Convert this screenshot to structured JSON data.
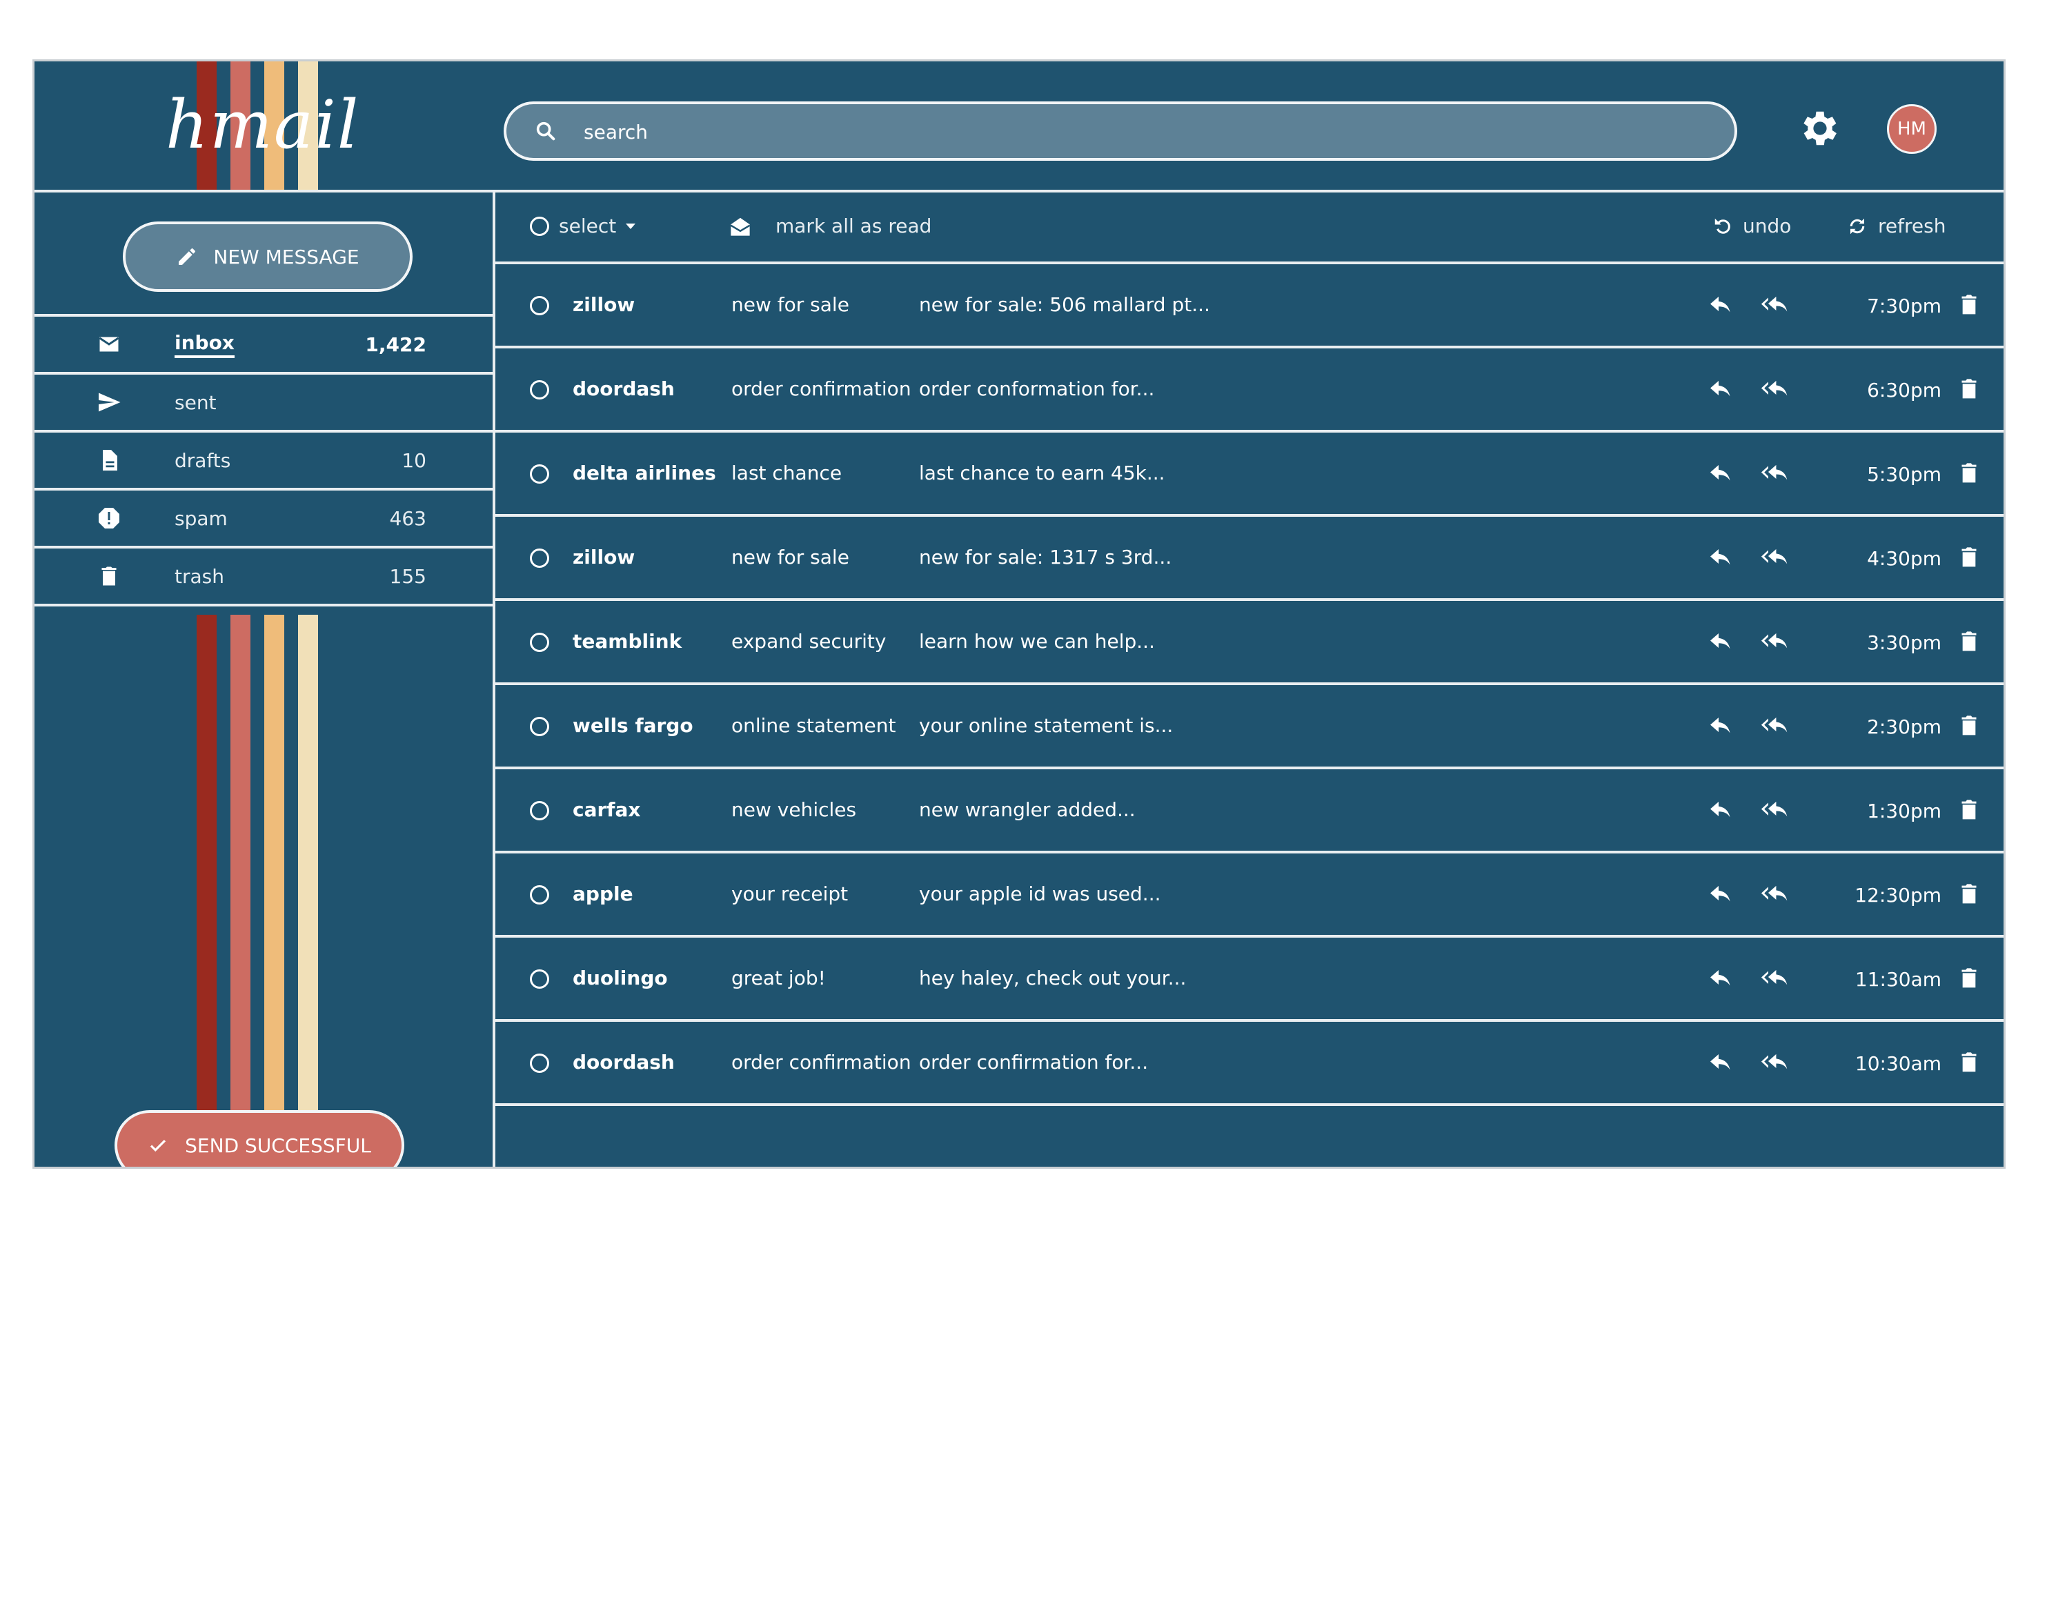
{
  "app": {
    "logo": "hmail"
  },
  "header": {
    "search_placeholder": "search",
    "avatar_initials": "HM"
  },
  "sidebar": {
    "new_message_label": "NEW MESSAGE",
    "items": [
      {
        "label": "inbox",
        "count": "1,422",
        "icon": "envelope-icon",
        "active": true
      },
      {
        "label": "sent",
        "count": "",
        "icon": "send-icon"
      },
      {
        "label": "drafts",
        "count": "10",
        "icon": "document-icon"
      },
      {
        "label": "spam",
        "count": "463",
        "icon": "alert-icon"
      },
      {
        "label": "trash",
        "count": "155",
        "icon": "trash-icon"
      }
    ],
    "toast_label": "SEND SUCCESSFUL"
  },
  "toolbar": {
    "select_label": "select",
    "mark_read_label": "mark all as read",
    "undo_label": "undo",
    "refresh_label": "refresh"
  },
  "emails": [
    {
      "from": "zillow",
      "subject": "new for sale",
      "preview": "new for sale: 506 mallard pt...",
      "time": "7:30pm"
    },
    {
      "from": "doordash",
      "subject": "order confirmation",
      "preview": "order conformation for...",
      "time": "6:30pm"
    },
    {
      "from": "delta airlines",
      "subject": "last chance",
      "preview": "last chance to earn 45k...",
      "time": "5:30pm"
    },
    {
      "from": "zillow",
      "subject": "new for sale",
      "preview": "new for sale: 1317 s 3rd...",
      "time": "4:30pm"
    },
    {
      "from": "teamblink",
      "subject": "expand security",
      "preview": "learn how we can help...",
      "time": "3:30pm"
    },
    {
      "from": "wells fargo",
      "subject": "online statement",
      "preview": "your online statement is...",
      "time": "2:30pm"
    },
    {
      "from": "carfax",
      "subject": "new vehicles",
      "preview": "new wrangler added...",
      "time": "1:30pm"
    },
    {
      "from": "apple",
      "subject": "your receipt",
      "preview": "your apple id was used...",
      "time": "12:30pm"
    },
    {
      "from": "duolingo",
      "subject": "great job!",
      "preview": "hey haley, check out your...",
      "time": "11:30am"
    },
    {
      "from": "doordash",
      "subject": "order confirmation",
      "preview": "order confirmation for...",
      "time": "10:30am"
    }
  ],
  "colors": {
    "background": "#1f536f",
    "accent": "#cd6c62",
    "search_bg": "#5d8196",
    "stripes": [
      "#9a2a1f",
      "#cd6c62",
      "#efbc7a",
      "#f1e0b8"
    ]
  }
}
